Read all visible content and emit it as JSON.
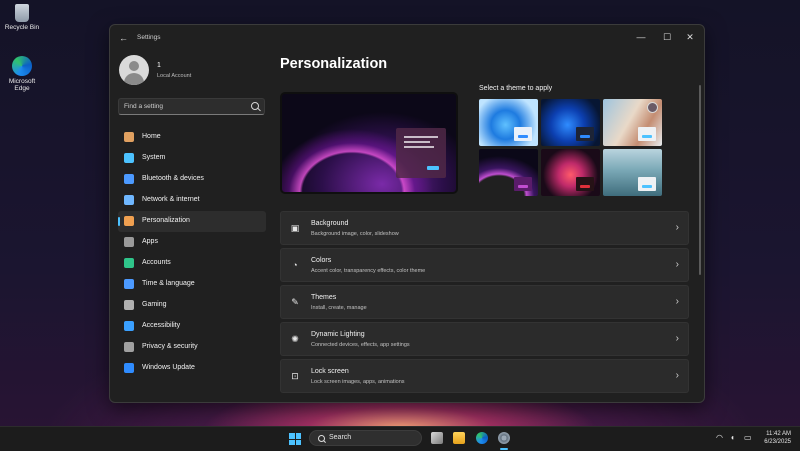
{
  "desktop": {
    "icons": [
      {
        "label": "Recycle Bin"
      },
      {
        "label": "Microsoft Edge"
      }
    ]
  },
  "window": {
    "title": "Settings",
    "back_symbol": "←",
    "controls": {
      "minimize": "—",
      "maximize": "☐",
      "close": "✕"
    }
  },
  "user": {
    "name": "1",
    "account_type": "Local Account"
  },
  "search": {
    "placeholder": "Find a setting"
  },
  "nav": {
    "items": [
      {
        "label": "Home",
        "icon": "home-icon",
        "color": "#e0a060"
      },
      {
        "label": "System",
        "icon": "monitor-icon",
        "color": "#4cc2ff"
      },
      {
        "label": "Bluetooth & devices",
        "icon": "bluetooth-icon",
        "color": "#4c9aff"
      },
      {
        "label": "Network & internet",
        "icon": "network-icon",
        "color": "#6fb7ff"
      },
      {
        "label": "Personalization",
        "icon": "brush-icon",
        "color": "#f0a050"
      },
      {
        "label": "Apps",
        "icon": "apps-icon",
        "color": "#9a9a9a"
      },
      {
        "label": "Accounts",
        "icon": "accounts-icon",
        "color": "#2fc58a"
      },
      {
        "label": "Time & language",
        "icon": "globe-clock-icon",
        "color": "#4c9aff"
      },
      {
        "label": "Gaming",
        "icon": "gamepad-icon",
        "color": "#b0b0b0"
      },
      {
        "label": "Accessibility",
        "icon": "accessibility-icon",
        "color": "#3aa0ff"
      },
      {
        "label": "Privacy & security",
        "icon": "shield-icon",
        "color": "#a0a0a0"
      },
      {
        "label": "Windows Update",
        "icon": "update-icon",
        "color": "#2f8cff"
      }
    ],
    "active_index": 4
  },
  "main": {
    "title": "Personalization",
    "theme_heading": "Select a theme to apply",
    "themes": [
      {
        "name": "theme-windows-light",
        "accent": "#2f8cff"
      },
      {
        "name": "theme-windows-dark",
        "accent": "#2f8cff"
      },
      {
        "name": "theme-glow",
        "accent": "#4cc2ff"
      },
      {
        "name": "theme-captured-motion",
        "accent": "#c04ed0"
      },
      {
        "name": "theme-flow",
        "accent": "#e0303a"
      },
      {
        "name": "theme-sunrise",
        "accent": "#4cc2ff"
      }
    ],
    "cards": [
      {
        "title": "Background",
        "subtitle": "Background image, color, slideshow",
        "icon": "image-icon"
      },
      {
        "title": "Colors",
        "subtitle": "Accent color, transparency effects, color theme",
        "icon": "palette-icon"
      },
      {
        "title": "Themes",
        "subtitle": "Install, create, manage",
        "icon": "pen-icon"
      },
      {
        "title": "Dynamic Lighting",
        "subtitle": "Connected devices, effects, app settings",
        "icon": "light-icon"
      },
      {
        "title": "Lock screen",
        "subtitle": "Lock screen images, apps, animations",
        "icon": "lock-screen-icon"
      }
    ]
  },
  "taskbar": {
    "search_label": "Search",
    "time": "11:42 AM",
    "date": "6/23/2025"
  },
  "accent": "#4cc2ff"
}
